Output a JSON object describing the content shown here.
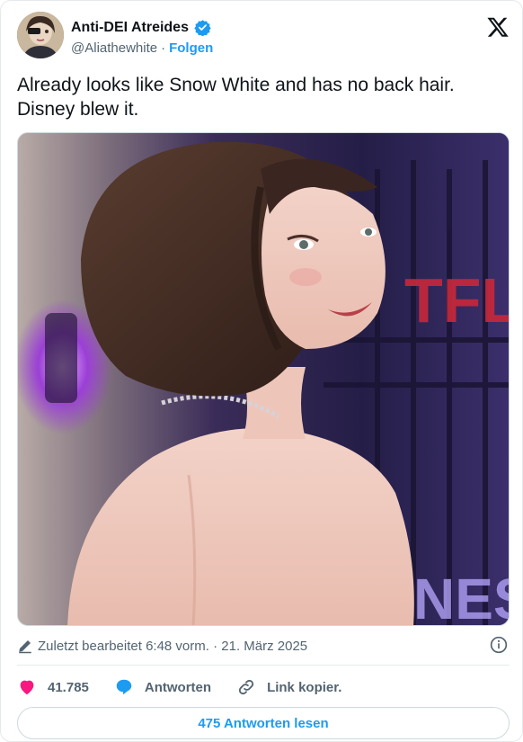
{
  "author": {
    "display_name": "Anti-DEI Atreides",
    "handle": "@Aliathewhite",
    "separator": "·",
    "follow_label": "Folgen",
    "verified_icon": "verified-badge-icon",
    "brand_logo": "x-logo-icon"
  },
  "tweet": {
    "text_line1": "Already looks like Snow White and has no back hair.",
    "text_line2": "Disney blew it."
  },
  "meta": {
    "edited_label": "Zuletzt bearbeitet 6:48 vorm. · 21. März 2025",
    "info_icon": "info-icon"
  },
  "actions": {
    "like_count": "41.785",
    "reply_label": "Antworten",
    "copy_link_label": "Link kopier."
  },
  "read_replies_label": "475 Antworten lesen",
  "colors": {
    "accent": "#1d9bf0",
    "like": "#f91880",
    "text": "#0f1419",
    "secondary_text": "#536471"
  }
}
